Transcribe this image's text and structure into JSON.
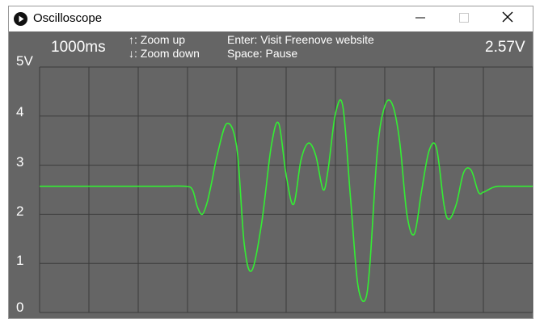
{
  "window": {
    "title": "Oscilloscope",
    "app_icon": "play-circle-icon",
    "controls": [
      "minimize-icon",
      "maximize-icon",
      "close-icon"
    ]
  },
  "hud": {
    "time_scale": "1000ms",
    "zoom_up_hint": "↑: Zoom up",
    "zoom_down_hint": "↓: Zoom down",
    "enter_hint": "Enter: Visit Freenove website",
    "space_hint": "Space: Pause",
    "voltage_readout": "2.57V"
  },
  "axis": {
    "y_labels": [
      "5V",
      "4",
      "3",
      "2",
      "1",
      "0"
    ]
  },
  "colors": {
    "background": "#656565",
    "grid": "#3c3c3c",
    "trace": "#33ee33",
    "text": "#ffffff"
  },
  "chart_data": {
    "type": "line",
    "ylim": [
      0,
      5
    ],
    "y_ticks": [
      "5V",
      "4",
      "3",
      "2",
      "1",
      "0"
    ],
    "grid": true,
    "x": [
      0,
      5,
      10,
      15,
      20,
      25,
      29.5,
      31,
      32,
      33,
      34,
      35,
      36,
      38,
      40,
      41.5,
      43,
      45,
      47,
      48.5,
      50,
      51.5,
      53,
      54.5,
      56,
      57.5,
      58.5,
      60,
      61.5,
      63,
      64.5,
      66,
      67,
      68.5,
      70,
      71.5,
      73,
      74.5,
      76,
      77.5,
      79,
      80.5,
      82,
      83,
      84.5,
      86,
      87.5,
      89,
      90,
      91,
      92,
      93,
      95,
      100
    ],
    "values": [
      2.57,
      2.57,
      2.57,
      2.57,
      2.57,
      2.57,
      2.57,
      2.5,
      2.15,
      2.0,
      2.25,
      2.7,
      3.2,
      3.85,
      3.35,
      1.4,
      0.85,
      1.8,
      3.4,
      3.85,
      2.8,
      2.2,
      3.1,
      3.45,
      3.2,
      2.5,
      2.9,
      4.05,
      4.2,
      2.4,
      0.6,
      0.25,
      1.0,
      3.3,
      4.2,
      4.25,
      3.5,
      2.0,
      1.6,
      2.5,
      3.3,
      3.35,
      2.2,
      1.9,
      2.2,
      2.85,
      2.9,
      2.45,
      2.45,
      2.5,
      2.55,
      2.57,
      2.57,
      2.57
    ]
  }
}
